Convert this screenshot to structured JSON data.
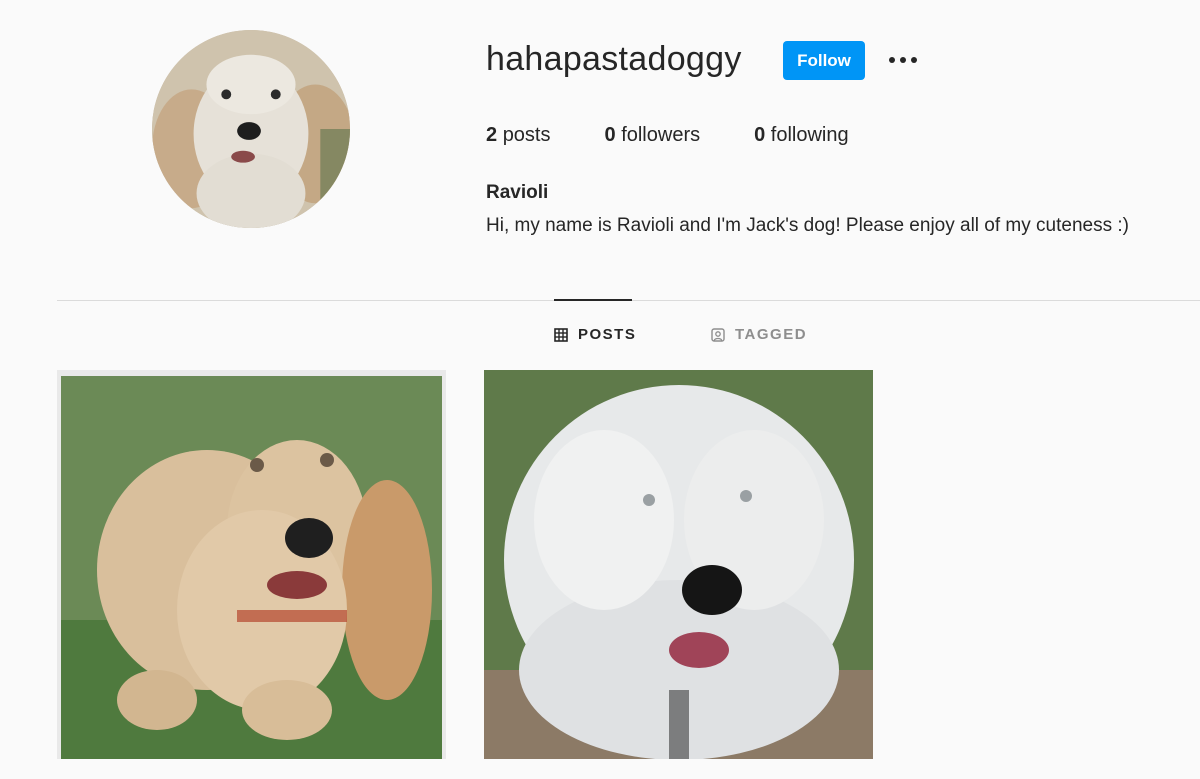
{
  "profile": {
    "username": "hahapastadoggy",
    "follow_label": "Follow",
    "more_icon": "more-options-icon",
    "stats": [
      {
        "count": "2",
        "label": "posts"
      },
      {
        "count": "0",
        "label": "followers"
      },
      {
        "count": "0",
        "label": "following"
      }
    ],
    "full_name": "Ravioli",
    "bio": "Hi, my name is Ravioli and I'm Jack's dog! Please enjoy all of my cuteness :)"
  },
  "tabs": [
    {
      "label": "POSTS",
      "icon": "grid-icon",
      "active": true
    },
    {
      "label": "TAGGED",
      "icon": "tagged-icon",
      "active": false
    }
  ],
  "posts": [
    {
      "subject": "golden-puppy-photo"
    },
    {
      "subject": "sheepdog-photo"
    }
  ],
  "colors": {
    "accent": "#0095f6",
    "background": "#fafafa",
    "text": "#262626",
    "muted": "#8e8e8e",
    "divider": "#dbdbdb"
  }
}
